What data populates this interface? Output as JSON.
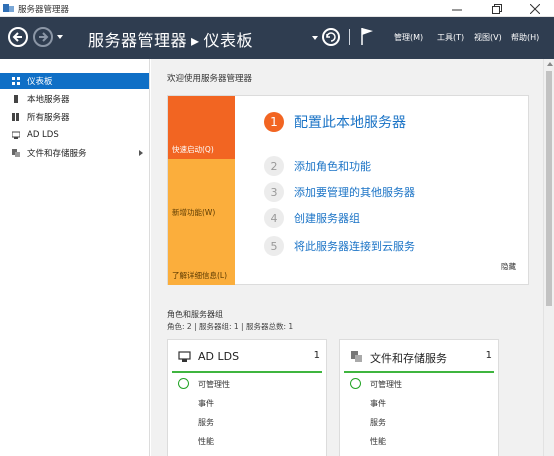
{
  "window": {
    "title": "服务器管理器"
  },
  "header": {
    "breadcrumb_root": "服务器管理器",
    "breadcrumb_sep": "▸",
    "breadcrumb_page": "仪表板",
    "menus": [
      "管理(M)",
      "工具(T)",
      "视图(V)",
      "帮助(H)"
    ]
  },
  "sidebar": {
    "items": [
      {
        "label": "仪表板",
        "icon": "dashboard-icon",
        "selected": true
      },
      {
        "label": "本地服务器",
        "icon": "server-icon"
      },
      {
        "label": "所有服务器",
        "icon": "servers-icon"
      },
      {
        "label": "AD LDS",
        "icon": "ad-lds-icon"
      },
      {
        "label": "文件和存储服务",
        "icon": "storage-icon",
        "has_children": true
      }
    ]
  },
  "welcome": {
    "title": "欢迎使用服务器管理器",
    "tiles": [
      "快速启动(Q)",
      "新增功能(W)",
      "了解详细信息(L)"
    ],
    "steps": [
      {
        "num": "1",
        "label": "配置此本地服务器"
      },
      {
        "num": "2",
        "label": "添加角色和功能"
      },
      {
        "num": "3",
        "label": "添加要管理的其他服务器"
      },
      {
        "num": "4",
        "label": "创建服务器组"
      },
      {
        "num": "5",
        "label": "将此服务器连接到云服务"
      }
    ],
    "hide": "隐藏"
  },
  "roles": {
    "title": "角色和服务器组",
    "summary": "角色: 2 | 服务器组: 1 | 服务器总数: 1",
    "cards": [
      {
        "title": "AD LDS",
        "count": "1",
        "rows": [
          "可管理性",
          "事件",
          "服务",
          "性能"
        ]
      },
      {
        "title": "文件和存储服务",
        "count": "1",
        "rows": [
          "可管理性",
          "事件",
          "服务",
          "性能"
        ]
      }
    ]
  },
  "colors": {
    "header_bg": "#2f3d50",
    "accent_orange": "#f26522",
    "tile_yellow": "#fbae3c",
    "link_blue": "#1a73c6",
    "ok_green": "#3fb53f",
    "selected_blue": "#0f6fc6"
  }
}
